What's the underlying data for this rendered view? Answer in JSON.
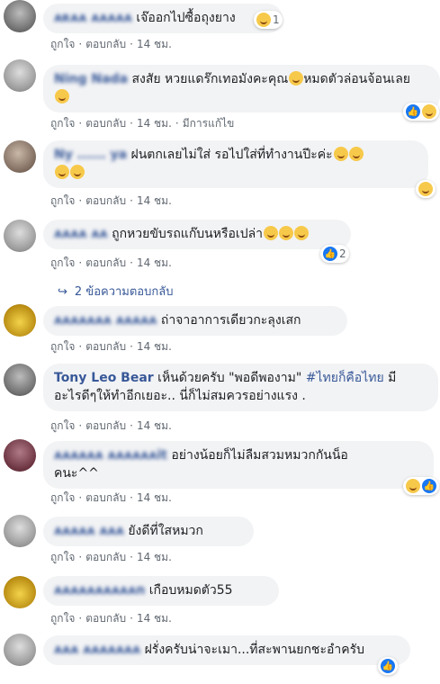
{
  "comments": [
    {
      "name": "ᴀʀᴀᴀ ᴀᴀᴀᴀᴀ",
      "text": "เจ๊ออกไปซื้อถุงยาง",
      "time": "14 ชม.",
      "reaction_count": "1"
    },
    {
      "name": "Ning Nada",
      "text": "สงสัย หวยแดร๊กเทอมังคะคุณ",
      "text2": "หมดตัวล่อนจ้อนเลย",
      "time": "14 ชม.",
      "edited": "มีการแก้ไข"
    },
    {
      "name": "Ny ...... ya",
      "text": "ฝนตกเลยไม่ใส่ รอไปใส่ที่ทำงานปีะค่ะ",
      "time": "14 ชม."
    },
    {
      "name": "ᴀᴀᴀᴀ ᴀᴀ",
      "text": "ถูกหวยขับรถแก๊บนหรือเปล่า",
      "time": "14 ชม.",
      "reaction_count": "2"
    },
    {
      "name": "ᴀᴀᴀᴀᴀᴀᴀ ᴀᴀᴀᴀᴀ",
      "text": "ถ่าจาอาการเดียวกะลุงเสก",
      "time": "14 ชม."
    },
    {
      "name": "Tony Leo Bear",
      "text": "เห็นด้วยครับ \"พอดีพองาม\"",
      "hashtag": "#ไทยก็คือไทย",
      "text_cont": "มี",
      "text_line2": "อะไรดีๆให้ทำอีกเยอะ.. นี่ก็ไม่สมควรอย่างแรง .",
      "time": "14 ชม."
    },
    {
      "name": "ᴀᴀᴀᴀᴀᴀ ᴀᴀᴀᴀᴀᴀit",
      "text": "อย่างน้อยก็ไม่ลืมสวมหมวกกันน็อ",
      "text_line2": "คนะ^^",
      "time": "14 ชม."
    },
    {
      "name": "ᴀᴀᴀᴀᴀ ᴀᴀᴀ",
      "text": "ยังดีที่ใสหมวก",
      "time": "14 ชม."
    },
    {
      "name": "ᴀᴀᴀᴀᴀᴀᴀᴀᴀᴀn",
      "text": "เกือบหมดตัว55",
      "time": "14 ชม."
    },
    {
      "name": "ᴀᴀᴀ ᴀᴀᴀᴀᴀᴀᴀ",
      "text": "ฝรั่งครับน่าจะเมา...ที่สะพานยกชะอำครับ",
      "time": ""
    }
  ],
  "labels": {
    "like": "ถูกใจ",
    "reply": "ตอบกลับ",
    "dot": "·",
    "replies_link": "2 ข้อความตอบกลับ"
  },
  "colors": {
    "name": "#385898",
    "bubble": "#f2f3f5",
    "meta": "#606770",
    "like_blue": "#1877f2"
  }
}
